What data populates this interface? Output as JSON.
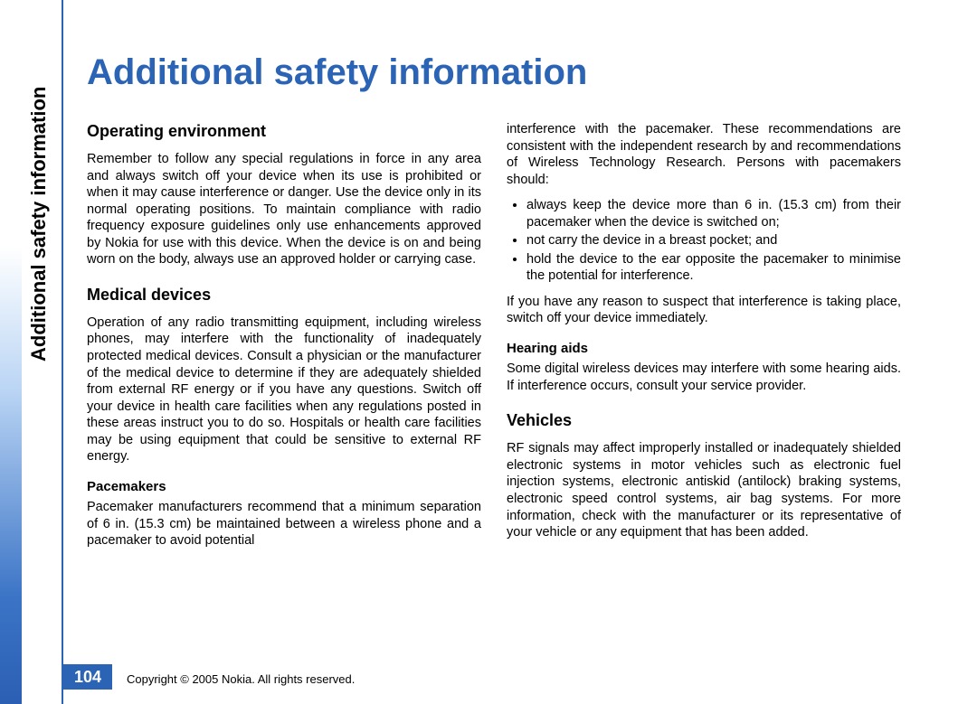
{
  "side_label": "Additional safety information",
  "title": "Additional safety information",
  "page_number": "104",
  "copyright": "Copyright © 2005 Nokia. All rights reserved.",
  "left_column": {
    "h_op_env": "Operating environment",
    "p_op_env": "Remember to follow any special regulations in force in any area and always switch off your device when its use is prohibited or when it may cause interference or danger. Use the device only in its normal operating positions. To maintain compliance with radio frequency exposure guidelines only use enhancements approved by Nokia for use with this device. When the device is on and being worn on the body, always use an approved holder or carrying case.",
    "h_med": "Medical devices",
    "p_med": "Operation of any radio transmitting equipment, including wireless phones, may interfere with the functionality of inadequately protected medical devices. Consult a physician or the manufacturer of the medical device to determine if they are adequately shielded from external RF energy or if you have any questions. Switch off your device in health care facilities when any regulations posted in these areas instruct you to do so. Hospitals or health care facilities may be using equipment that could be sensitive to external RF energy.",
    "h_pace": "Pacemakers",
    "p_pace": "Pacemaker manufacturers recommend that a minimum separation of 6 in. (15.3 cm) be maintained between a wireless phone and a pacemaker to avoid potential"
  },
  "right_column": {
    "p_cont": "interference with the pacemaker. These recommendations are consistent with the independent research by and recommendations of Wireless Technology Research. Persons with pacemakers should:",
    "bullets": [
      "always keep the device more than 6 in. (15.3 cm) from their pacemaker when the device is switched on;",
      "not carry the device in a breast pocket; and",
      "hold the device to the ear opposite the pacemaker to minimise the potential for interference."
    ],
    "p_suspect": "If you have any reason to suspect that interference is taking place, switch off your device immediately.",
    "h_hear": "Hearing aids",
    "p_hear": "Some digital wireless devices may interfere with some hearing aids. If interference occurs, consult your service provider.",
    "h_veh": "Vehicles",
    "p_veh": "RF signals may affect improperly installed or inadequately shielded electronic systems in motor vehicles such as electronic fuel injection systems, electronic antiskid (antilock) braking systems, electronic speed control systems, air bag systems. For more information, check with the manufacturer or its representative of your vehicle or any equipment that has been added."
  }
}
